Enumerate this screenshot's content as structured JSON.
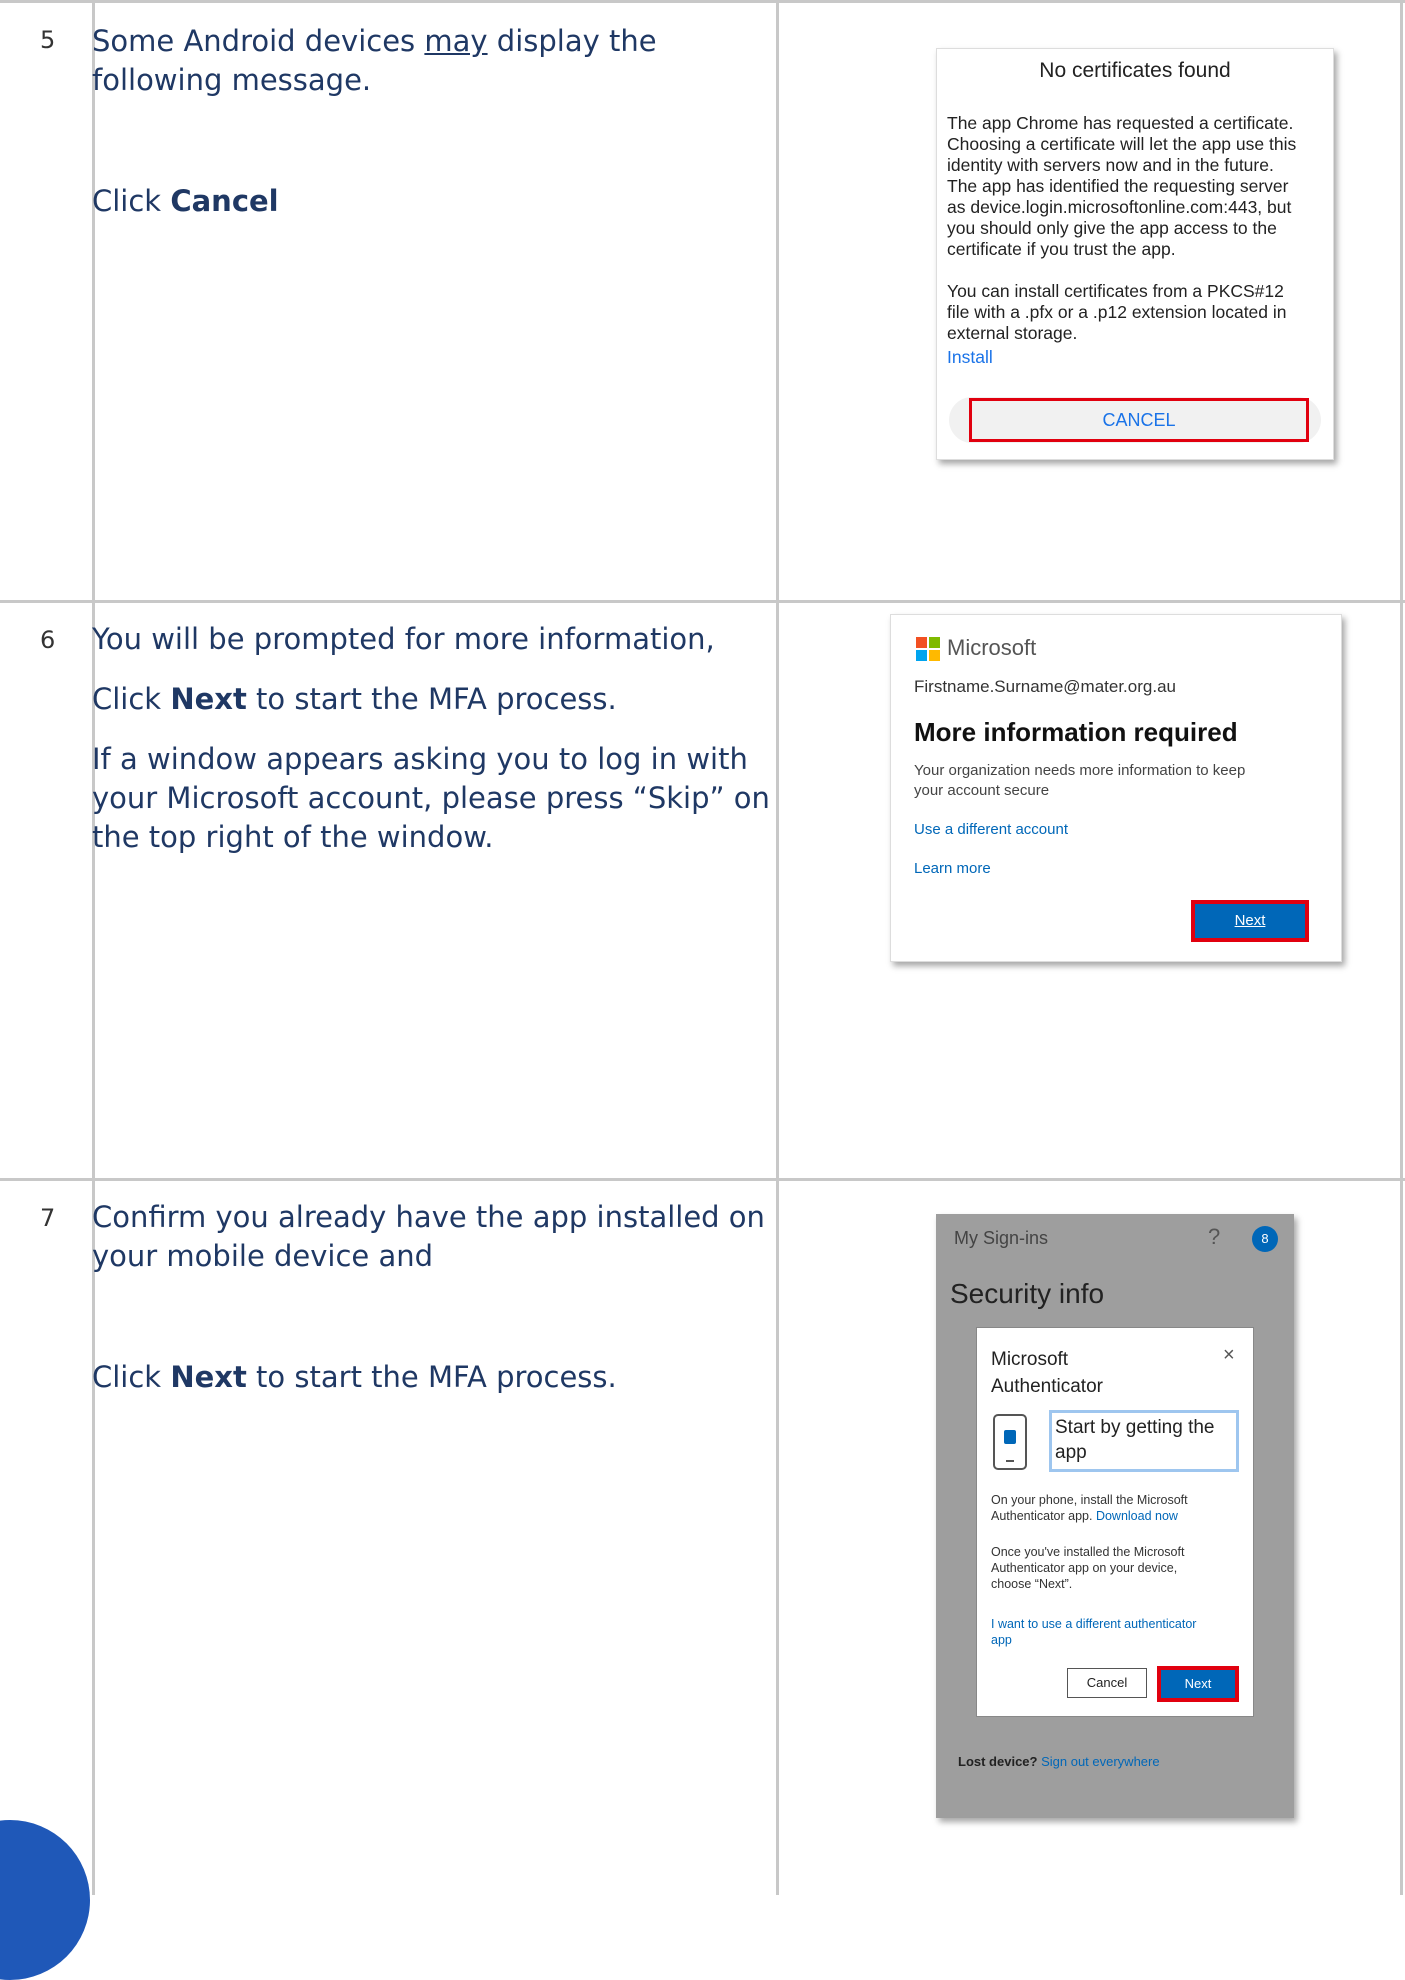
{
  "rows": [
    {
      "num": "5",
      "lines": [
        "Some Android devices ",
        "may",
        " display the",
        "following message."
      ],
      "click_prefix": "Click ",
      "click_bold": "Cancel"
    },
    {
      "num": "6",
      "p1": "You will be prompted for more information,",
      "p2_prefix": "Click ",
      "p2_bold": "Next",
      "p2_suffix": " to start the MFA process.",
      "p3": [
        "If a window appears asking you to log in with",
        "your Microsoft account, please press “Skip” on",
        "the top right of the window."
      ]
    },
    {
      "num": "7",
      "p1": [
        "Confirm you already have the app installed on",
        "your mobile device and"
      ],
      "p2_prefix": "Click ",
      "p2_bold": "Next",
      "p2_suffix": " to start the MFA process."
    }
  ],
  "cert_dialog": {
    "title": "No certificates found",
    "body1": [
      "The app Chrome has requested a certificate.",
      "Choosing a certificate will let the app use this",
      "identity with servers now and in the future.",
      "The app has identified the requesting server",
      "as device.login.microsoftonline.com:443, but",
      "you should only give the app access to the",
      "certificate if you trust the app."
    ],
    "body2": [
      "You can install certificates from a PKCS#12",
      "file with a .pfx or a .p12 extension located in",
      "external storage."
    ],
    "install": "Install",
    "cancel": "CANCEL"
  },
  "ms_dialog": {
    "brand": "Microsoft",
    "email": "Firstname.Surname@mater.org.au",
    "heading": "More information required",
    "para": [
      "Your organization needs more information to keep",
      "your account secure"
    ],
    "link1": "Use a different account",
    "link2": "Learn more",
    "next": "Next",
    "logo_colors": [
      "#f25022",
      "#7fba00",
      "#00a4ef",
      "#ffb900"
    ]
  },
  "auth_screen": {
    "topbar": "My Sign-ins",
    "help": "?",
    "avatar": "8",
    "heading": "Security info",
    "dialog_title": [
      "Microsoft",
      "Authenticator"
    ],
    "close": "×",
    "start": [
      "Start by getting the",
      "app"
    ],
    "p1": [
      "On your phone, install the Microsoft",
      "Authenticator app. "
    ],
    "download": "Download now",
    "p2": [
      "Once you've installed the Microsoft",
      "Authenticator app on your device,",
      "choose “Next”."
    ],
    "p3": [
      "I want to use a different authenticator",
      "app"
    ],
    "cancel": "Cancel",
    "next": "Next",
    "lost_prefix": "Lost device? ",
    "lost_link": "Sign out everywhere"
  }
}
